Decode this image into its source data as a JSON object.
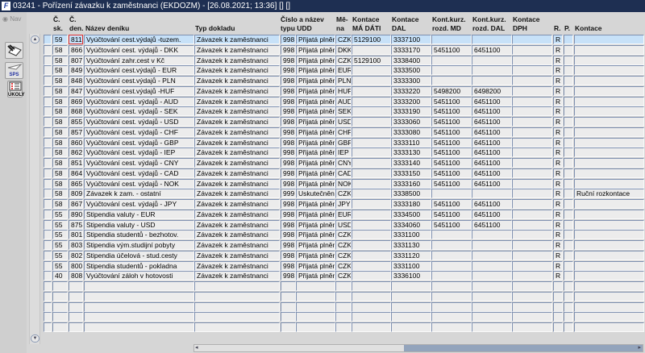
{
  "window": {
    "title": "03241 - Pořízení závazku k zaměstnanci (EKDOZM) - [26.08.2021; 13:36] [] []",
    "logo": "VF"
  },
  "toolbar": {
    "nav_label": "Nav",
    "sps_label": "SPS",
    "ukoly_label": "ÚKOLY"
  },
  "colors": {
    "titlebar": "#1e2f52",
    "selected_row": "#c7e1f8",
    "cell_border": "#7e90b0"
  },
  "headers": {
    "sk": [
      "Č.",
      "sk."
    ],
    "den": [
      "Č.",
      "den."
    ],
    "nazev": "Název deníku",
    "typ": "Typ dokladu",
    "udd": [
      "Číslo a název",
      "typu UDD"
    ],
    "mena": [
      "Mě-",
      "na"
    ],
    "md": [
      "Kontace",
      "MÁ DÁTI"
    ],
    "dal": [
      "Kontace",
      "DAL"
    ],
    "rmd": [
      "Kont.kurz.",
      "rozd. MD"
    ],
    "rdal": [
      "Kont.kurz.",
      "rozd. DAL"
    ],
    "dph": [
      "Kontace",
      "DPH"
    ],
    "r": "R.",
    "p": "P.",
    "kontace": "Kontace"
  },
  "rows": [
    [
      "59",
      "811",
      "Vyúčtování cest.výdajů -tuzem.",
      "Závazek k zaměstnanci",
      "998",
      "Přijatá plnění z",
      "CZK",
      "5129100",
      "3337100",
      "",
      "",
      "",
      "R",
      "",
      ""
    ],
    [
      "58",
      "866",
      "Vyúčtování cest. výdajů - DKK",
      "Závazek k zaměstnanci",
      "998",
      "Přijatá plnění z",
      "DKK",
      "",
      "3333170",
      "5451100",
      "6451100",
      "",
      "R",
      "",
      ""
    ],
    [
      "58",
      "807",
      "Vyúčtování zahr.cest v Kč",
      "Závazek k zaměstnanci",
      "998",
      "Přijatá plnění z",
      "CZK",
      "5129100",
      "3338400",
      "",
      "",
      "",
      "R",
      "",
      ""
    ],
    [
      "58",
      "849",
      "Vyúčtování cest.výdajů - EUR",
      "Závazek k zaměstnanci",
      "998",
      "Přijatá plnění z",
      "EUR",
      "",
      "3333500",
      "",
      "",
      "",
      "R",
      "",
      ""
    ],
    [
      "58",
      "848",
      "Vyúčtování  cest.výdajů - PLN",
      "Závazek k zaměstnanci",
      "998",
      "Přijatá plnění z",
      "PLN",
      "",
      "3333300",
      "",
      "",
      "",
      "R",
      "",
      ""
    ],
    [
      "58",
      "847",
      "Vyúčtování  cest.výdajů -HUF",
      "Závazek k zaměstnanci",
      "998",
      "Přijatá plnění z",
      "HUF",
      "",
      "3333220",
      "5498200",
      "6498200",
      "",
      "R",
      "",
      ""
    ],
    [
      "58",
      "869",
      "Vyúčtování cest. výdajů - AUD",
      "Závazek k zaměstnanci",
      "998",
      "Přijatá plnění z",
      "AUD",
      "",
      "3333200",
      "5451100",
      "6451100",
      "",
      "R",
      "",
      ""
    ],
    [
      "58",
      "868",
      "Vyúčtování cest. výdajů - SEK",
      "Závazek k zaměstnanci",
      "998",
      "Přijatá plnění z",
      "SEK",
      "",
      "3333190",
      "5451100",
      "6451100",
      "",
      "R",
      "",
      ""
    ],
    [
      "58",
      "855",
      "Vyúčtování cest. výdajů - USD",
      "Závazek k zaměstnanci",
      "998",
      "Přijatá plnění z",
      "USD",
      "",
      "3333060",
      "5451100",
      "6451100",
      "",
      "R",
      "",
      ""
    ],
    [
      "58",
      "857",
      "Vyúčtování cest. výdajů - CHF",
      "Závazek k zaměstnanci",
      "998",
      "Přijatá plnění z",
      "CHF",
      "",
      "3333080",
      "5451100",
      "6451100",
      "",
      "R",
      "",
      ""
    ],
    [
      "58",
      "860",
      "Vyúčtování cest. výdajů - GBP",
      "Závazek k zaměstnanci",
      "998",
      "Přijatá plnění z",
      "GBP",
      "",
      "3333110",
      "5451100",
      "6451100",
      "",
      "R",
      "",
      ""
    ],
    [
      "58",
      "862",
      "Vyúčtování cest. výdajů - IEP",
      "Závazek k zaměstnanci",
      "998",
      "Přijatá plnění z",
      "IEP",
      "",
      "3333130",
      "5451100",
      "6451100",
      "",
      "R",
      "",
      ""
    ],
    [
      "58",
      "851",
      "Vyúčtování cest. výdajů  - CNY",
      "Závazek k zaměstnanci",
      "998",
      "Přijatá plnění z",
      "CNY",
      "",
      "3333140",
      "5451100",
      "6451100",
      "",
      "R",
      "",
      ""
    ],
    [
      "58",
      "864",
      "Vyúčtování cest. výdajů - CAD",
      "Závazek k zaměstnanci",
      "998",
      "Přijatá plnění z",
      "CAD",
      "",
      "3333150",
      "5451100",
      "6451100",
      "",
      "R",
      "",
      ""
    ],
    [
      "58",
      "865",
      "Vyúčtování cest. výdajů - NOK",
      "Závazek k zaměstnanci",
      "998",
      "Přijatá plnění z",
      "NOK",
      "",
      "3333160",
      "5451100",
      "6451100",
      "",
      "R",
      "",
      ""
    ],
    [
      "58",
      "809",
      "Závazek k zam. - ostatní",
      "Závazek k zaměstnanci",
      "999",
      "Uskutečněná plnění",
      "CZK",
      "",
      "3338500",
      "",
      "",
      "",
      "R",
      "",
      "Ruční rozkontace"
    ],
    [
      "58",
      "867",
      "Vyúčtování cest. výdajů - JPY",
      "Závazek k zaměstnanci",
      "998",
      "Přijatá plnění z",
      "JPY",
      "",
      "3333180",
      "5451100",
      "6451100",
      "",
      "R",
      "",
      ""
    ],
    [
      "55",
      "890",
      "Stipendia valuty - EUR",
      "Závazek k zaměstnanci",
      "998",
      "Přijatá plnění z",
      "EUR",
      "",
      "3334500",
      "5451100",
      "6451100",
      "",
      "R",
      "",
      ""
    ],
    [
      "55",
      "875",
      "Stipendia valuty - USD",
      "Závazek k zaměstnanci",
      "998",
      "Přijatá plnění z",
      "USD",
      "",
      "3334060",
      "5451100",
      "6451100",
      "",
      "R",
      "",
      ""
    ],
    [
      "55",
      "801",
      "Stipendia studentů - bezhotov.",
      "Závazek k zaměstnanci",
      "998",
      "Přijatá plnění z",
      "CZK",
      "",
      "3331100",
      "",
      "",
      "",
      "R",
      "",
      ""
    ],
    [
      "55",
      "803",
      "Stipendia vým.studijní pobyty",
      "Závazek k zaměstnanci",
      "998",
      "Přijatá plnění z",
      "CZK",
      "",
      "3331130",
      "",
      "",
      "",
      "R",
      "",
      ""
    ],
    [
      "55",
      "802",
      "Stipendia účelová - stud.cesty",
      "Závazek k zaměstnanci",
      "998",
      "Přijatá plnění z",
      "CZK",
      "",
      "3331120",
      "",
      "",
      "",
      "R",
      "",
      ""
    ],
    [
      "55",
      "800",
      "Stipendia studentů - pokladna",
      "Závazek k zaměstnanci",
      "998",
      "Přijatá plnění z",
      "CZK",
      "",
      "3331100",
      "",
      "",
      "",
      "R",
      "",
      ""
    ],
    [
      "40",
      "808",
      "Vyúčtování záloh v hotovosti",
      "Závazek k zaměstnanci",
      "998",
      "Přijatá plnění z",
      "CZK",
      "",
      "3336100",
      "",
      "",
      "",
      "R",
      "",
      ""
    ]
  ]
}
